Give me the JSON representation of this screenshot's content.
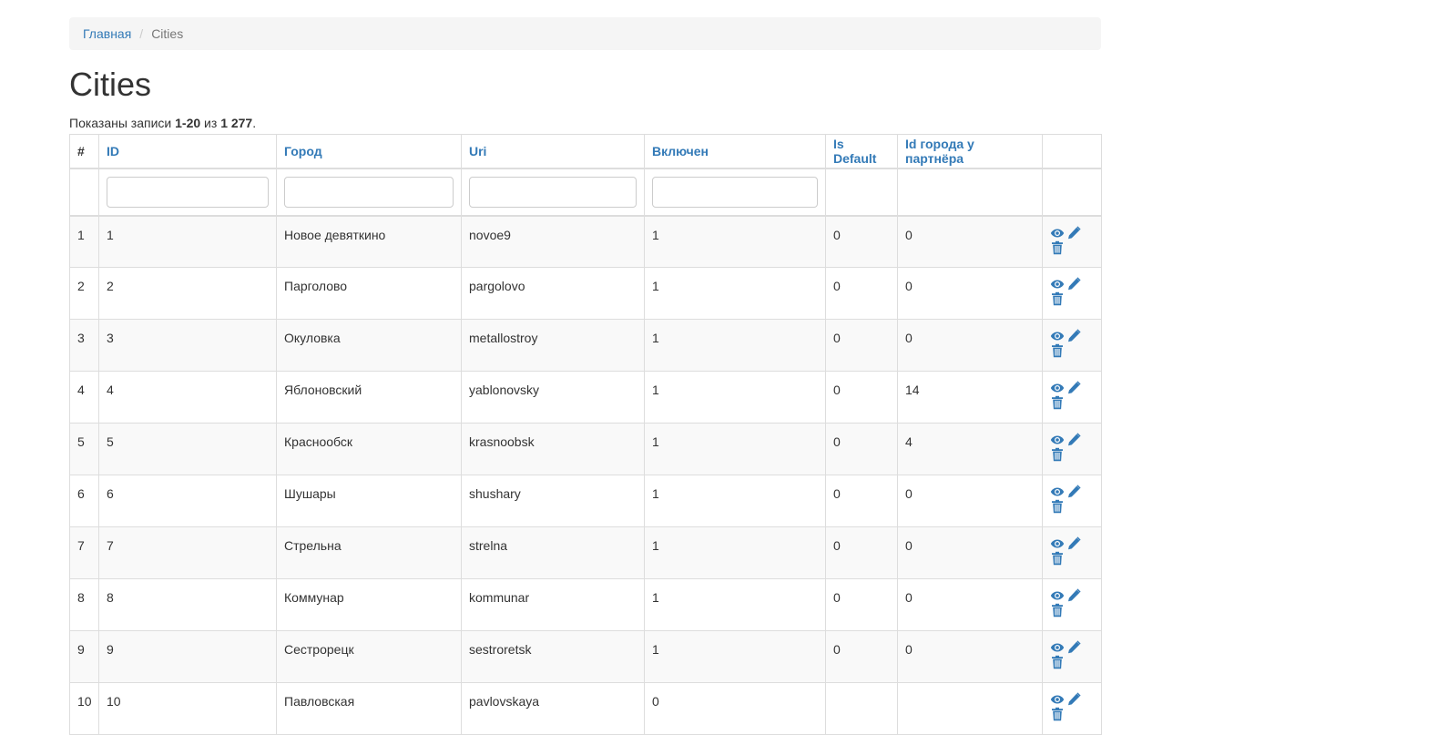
{
  "breadcrumb": {
    "home": "Главная",
    "separator": "/",
    "current": "Cities"
  },
  "page_title": "Cities",
  "summary": {
    "prefix": "Показаны записи ",
    "range": "1-20",
    "middle": " из ",
    "total": "1 277",
    "suffix": "."
  },
  "columns": {
    "num": "#",
    "id": "ID",
    "city": "Город",
    "uri": "Uri",
    "enabled": "Включен",
    "is_default": "Is Default",
    "partner_city_id": "Id города у партнёра"
  },
  "filters": {
    "id": "",
    "city": "",
    "uri": "",
    "enabled": ""
  },
  "rows": [
    {
      "num": "1",
      "id": "1",
      "city": "Новое девяткино",
      "uri": "novoe9",
      "enabled": "1",
      "is_default": "0",
      "partner_city_id": "0"
    },
    {
      "num": "2",
      "id": "2",
      "city": "Парголово",
      "uri": "pargolovo",
      "enabled": "1",
      "is_default": "0",
      "partner_city_id": "0"
    },
    {
      "num": "3",
      "id": "3",
      "city": "Окуловка",
      "uri": "metallostroy",
      "enabled": "1",
      "is_default": "0",
      "partner_city_id": "0"
    },
    {
      "num": "4",
      "id": "4",
      "city": "Яблоновский",
      "uri": "yablonovsky",
      "enabled": "1",
      "is_default": "0",
      "partner_city_id": "14"
    },
    {
      "num": "5",
      "id": "5",
      "city": "Краснообск",
      "uri": "krasnoobsk",
      "enabled": "1",
      "is_default": "0",
      "partner_city_id": "4"
    },
    {
      "num": "6",
      "id": "6",
      "city": "Шушары",
      "uri": "shushary",
      "enabled": "1",
      "is_default": "0",
      "partner_city_id": "0"
    },
    {
      "num": "7",
      "id": "7",
      "city": "Стрельна",
      "uri": "strelna",
      "enabled": "1",
      "is_default": "0",
      "partner_city_id": "0"
    },
    {
      "num": "8",
      "id": "8",
      "city": "Коммунар",
      "uri": "kommunar",
      "enabled": "1",
      "is_default": "0",
      "partner_city_id": "0"
    },
    {
      "num": "9",
      "id": "9",
      "city": "Сестрорецк",
      "uri": "sestroretsk",
      "enabled": "1",
      "is_default": "0",
      "partner_city_id": "0"
    },
    {
      "num": "10",
      "id": "10",
      "city": "Павловская",
      "uri": "pavlovskaya",
      "enabled": "0",
      "is_default": "",
      "partner_city_id": ""
    }
  ],
  "icons": {
    "view": "eye-icon",
    "update": "pencil-icon",
    "delete": "trash-icon",
    "color": "#337ab7"
  }
}
